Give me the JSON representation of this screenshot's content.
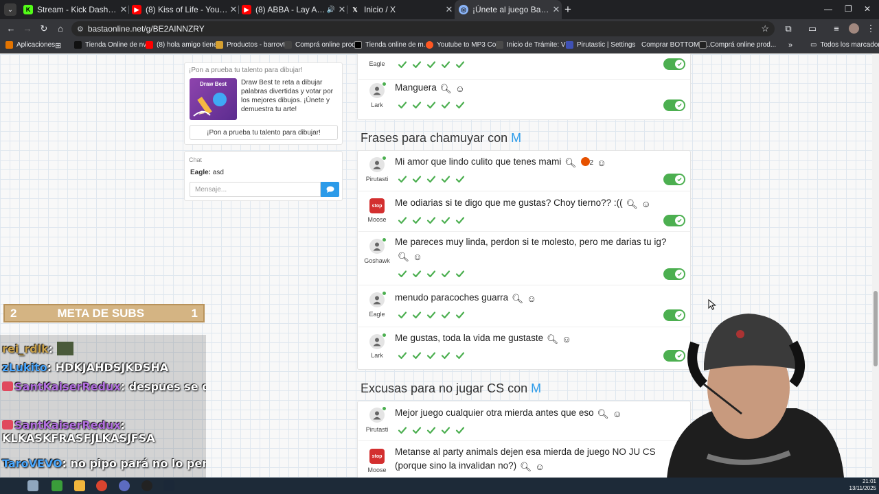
{
  "browser": {
    "tabs": [
      {
        "title": "Stream - Kick Dashboard",
        "icon": "kick-icon"
      },
      {
        "title": "(8) Kiss of Life - YouTube",
        "icon": "youtube-icon"
      },
      {
        "title": "(8) ABBA - Lay All Your Love",
        "icon": "youtube-icon"
      },
      {
        "title": "Inicio / X",
        "icon": "x-icon"
      },
      {
        "title": "¡Únete al juego Basta!",
        "icon": "basta-icon"
      }
    ],
    "url": "bastaonline.net/g/BE2AINNZRY",
    "bookmarks": [
      "Aplicaciones",
      "Tienda Online de nv...",
      "(8) hola amigo tiene...",
      "Productos - barrovtg",
      "Comprá online prod...",
      "Tienda online de m...",
      "Youtube to MP3 Co...",
      "Inicio de Trámite: Vi...",
      "Pirutastic | Settings",
      "Comprar BOTTOM e...",
      "Comprá online prod...",
      "Todos los marcadores"
    ]
  },
  "promo": {
    "heading": "¡Pon a prueba tu talento para dibujar!",
    "image_title": "Draw Best",
    "description": "Draw Best te reta a dibujar palabras divertidas y votar por los mejores dibujos. ¡Únete y demuestra tu arte!",
    "button": "¡Pon a prueba tu talento para dibujar!"
  },
  "chat": {
    "heading": "Chat",
    "messages": [
      {
        "user": "Eagle:",
        "text": "asd"
      }
    ],
    "placeholder": "Mensaje..."
  },
  "top_answers": [
    {
      "player": "Eagle",
      "text": ""
    },
    {
      "player": "Lark",
      "text": "Manguera"
    }
  ],
  "categories": [
    {
      "title": "Frases para chamuyar con",
      "letter": "M",
      "answers": [
        {
          "player": "Pirutasti",
          "text": "Mi amor que lindo culito que tenes mami",
          "reaction_count": "2"
        },
        {
          "player": "Moose",
          "text": "Me odiarias si te digo que me gustas? Choy tierno?? :(("
        },
        {
          "player": "Goshawk",
          "text": "Me pareces muy linda, perdon si te molesto, pero me darias tu ig?"
        },
        {
          "player": "Eagle",
          "text": "menudo paracoches guarra"
        },
        {
          "player": "Lark",
          "text": "Me gustas, toda la vida me gustaste"
        }
      ]
    },
    {
      "title": "Excusas para no jugar CS con",
      "letter": "M",
      "answers": [
        {
          "player": "Pirutasti",
          "text": "Mejor juego cualquier otra mierda antes que eso"
        },
        {
          "player": "Moose",
          "text": "Metanse al party animals dejen esa mierda de juego NO JU CS (porque sino la invalidan no?)"
        }
      ]
    }
  ],
  "overlay": {
    "meta_left": "2",
    "meta_label": "META DE SUBS",
    "meta_right": "1",
    "stream_chat": [
      {
        "user": "rei_rdlk",
        "text": ""
      },
      {
        "user": "zLukito",
        "text": "HDKJAHDSJKDSHA"
      },
      {
        "user": "SantKaiserRedux",
        "text": "despues se quejan del super sida"
      },
      {
        "user": "SantKaiserRedux",
        "text": "KLKASKFRASFJLKASJFSA"
      },
      {
        "user": "TaroVEVO",
        "text": "no pipo pará no lo pensé así"
      }
    ]
  },
  "taskbar": {
    "time": "21:01",
    "date": "13/11/2025"
  },
  "colors": {
    "accent": "#2c9be9",
    "valid": "#4caf50"
  }
}
